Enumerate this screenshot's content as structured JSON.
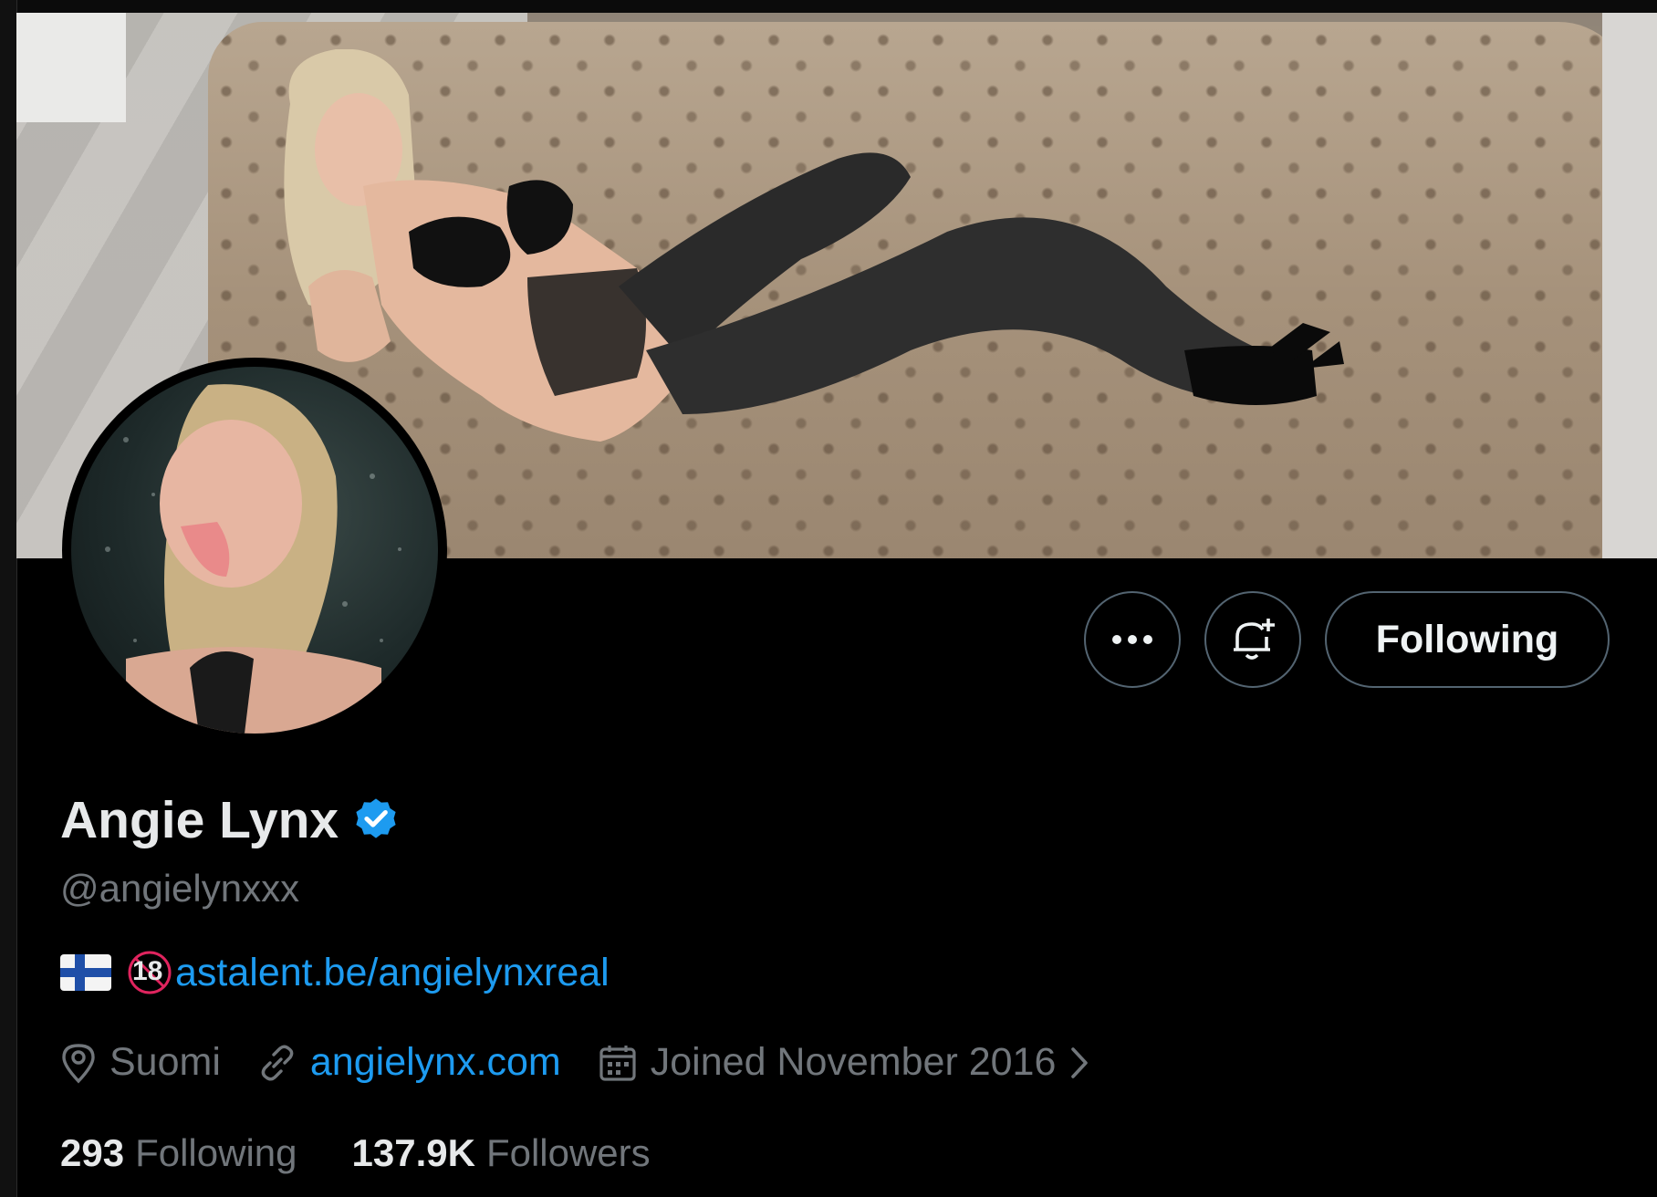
{
  "profile": {
    "display_name": "Angie Lynx",
    "verified": true,
    "handle": "@angielynxxx",
    "bio": {
      "flag_icon": "finland-flag-icon",
      "age_icon": "no-under-18-icon",
      "age_icon_text": "18",
      "link_text": "astalent.be/angielynxreal"
    },
    "meta": {
      "location": "Suomi",
      "website": "angielynx.com",
      "joined": "Joined November 2016"
    },
    "stats": {
      "following_count": "293",
      "following_label": "Following",
      "followers_count": "137.9K",
      "followers_label": "Followers"
    }
  },
  "actions": {
    "more_icon": "more-options-icon",
    "notify_icon": "bell-plus-icon",
    "follow_label": "Following"
  },
  "colors": {
    "background": "#000000",
    "text_primary": "#e7e9ea",
    "text_secondary": "#71767b",
    "link": "#1d9bf0",
    "button_border": "#536471",
    "verified_badge": "#1d9bf0"
  }
}
